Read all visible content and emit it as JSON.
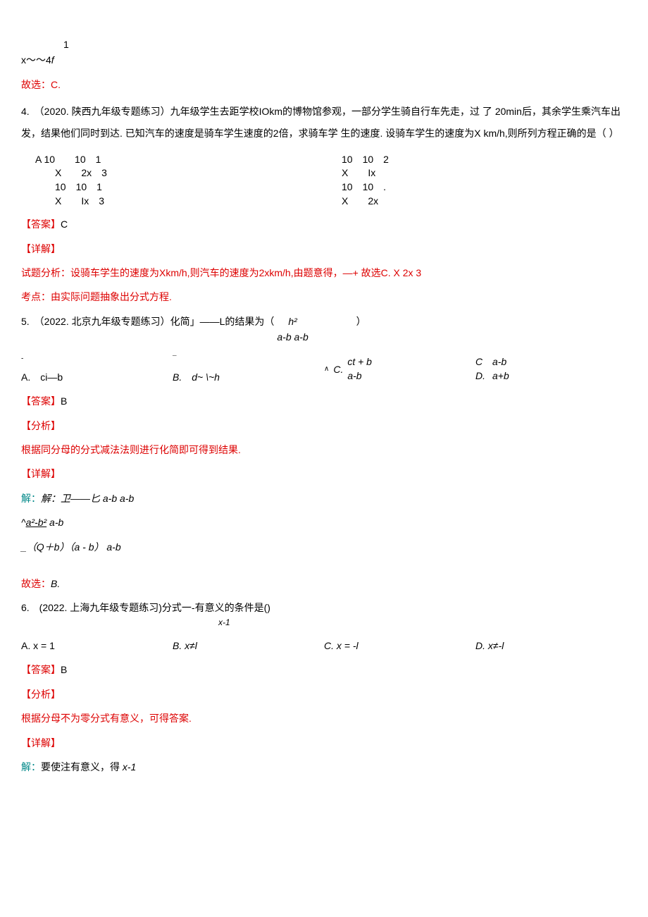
{
  "top_fragment": {
    "line1": "1",
    "line2": "x～～4<i>f</i>"
  },
  "ans_line_c": "故选：C.",
  "q4": {
    "prefix": "4.　（2020. 陕西九年级专题练习）九年级学生去距学校IOkm的博物馆参观，一部分学生骑自行车先走，过 了 20min后，其余学生乘汽车出发，结果他们同时到达. 已知汽车的速度是骑车学生速度的2倍，求骑车学 生的速度. 设骑车学生的速度为X km/h,则所列方程正确的是（ ）",
    "optA_label": "A 10",
    "row1_l1": "10　1",
    "row1_r1a": "10　10　2",
    "row2_l": "X　　2x　3",
    "row2_r": "X　　Ix",
    "row3_l": "10　10　1",
    "row3_r": "10　10　.",
    "row4_l": "X　　Ix　3",
    "row4_r": "X　　2x",
    "ans_label": "【答案】",
    "ans_val": "C",
    "detail_label": "【详解】",
    "analysis": "试题分析：设骑车学生的速度为Xkm/h,则汽车的速度为2xkm/h,由题意得，—+ 故选C. X 2x 3",
    "point": "考点：由实际问题抽象出分式方程."
  },
  "q5": {
    "prefix": "5.　（2022. 北京九年级专题练习）化简」——L的结果为（",
    "frac_num": "h²",
    "frac_denom": "a-b a-b",
    "close": "）",
    "optA": "A.　ci—b",
    "optB": "B.　d~ \\~h",
    "optC_lbl": "C.",
    "optC_num": "ct + b",
    "optC_den": "a-b",
    "optD_lblC": "C",
    "optD_lblD": "D.",
    "optD_num": "a-b",
    "optD_den": "a+b",
    "ans_label": "【答案】",
    "ans_val": "B",
    "analyze_label": "【分析】",
    "analyze_text": "根据同分母的分式减法法则进行化简即可得到结果.",
    "detail_label": "【详解】",
    "sol_line1": "解：卫——匕 a-b a-b",
    "sol_line2_pre": "^",
    "sol_line2_u": "a²-b²",
    "sol_line2_post": " a-b",
    "sol_line3": "_（Q＋b）（a - b） a-b",
    "ans_final_prefix": "故选：",
    "ans_final_val": "B."
  },
  "q6": {
    "prefix": "6.　(2022. 上海九年级专题练习)分式一-有意义的条件是()",
    "denom": "x-1",
    "optA": "A. x = 1",
    "optB": "B. x≠l",
    "optC": "C. x = -l",
    "optD": "D. x≠-l",
    "ans_label": "【答案】",
    "ans_val": "B",
    "analyze_label": "【分析】",
    "analyze_text": "根据分母不为零分式有意义，可得答案.",
    "detail_label": "【详解】",
    "sol_line": "解：要使注有意义，得 x-1"
  }
}
